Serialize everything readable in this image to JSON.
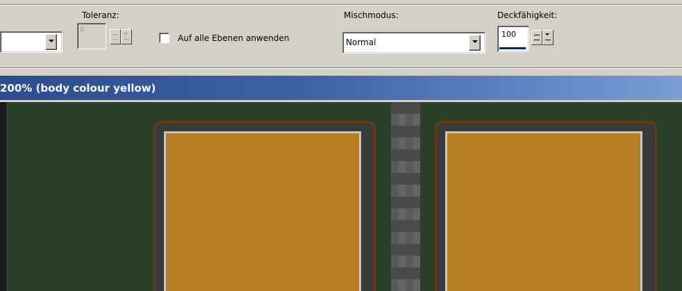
{
  "toolbar": {
    "tolerance": {
      "label": "Toleranz:",
      "value": "0"
    },
    "apply_all_layers": {
      "label": "Auf alle Ebenen anwenden",
      "checked": false
    },
    "blend_mode": {
      "label": "Mischmodus:",
      "value": "Normal"
    },
    "opacity": {
      "label": "Deckfähigkeit:",
      "value": "100"
    }
  },
  "document": {
    "title": "200% (body colour yellow)"
  },
  "colors": {
    "canvas_bg": "#2a4129",
    "panel_fill": "#b57e22",
    "panel_frame": "#3a3a3a",
    "panel_border": "#6a3a12",
    "titlebar_start": "#2c4c8e",
    "titlebar_end": "#7a9dd4"
  },
  "icons": [
    "chevron-down-icon",
    "spin-up-icon",
    "spin-down-icon",
    "checkbox-icon"
  ]
}
